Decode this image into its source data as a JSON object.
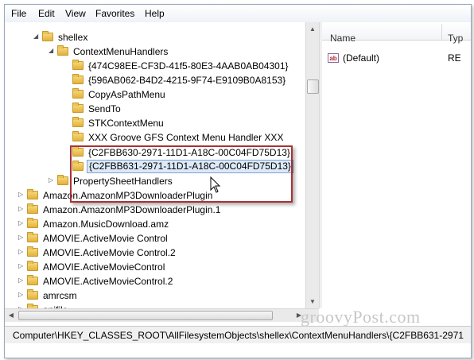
{
  "menu": {
    "items": [
      "File",
      "Edit",
      "View",
      "Favorites",
      "Help"
    ]
  },
  "tree": {
    "rows": [
      {
        "label": "shellex",
        "expander": "◢"
      },
      {
        "label": "ContextMenuHandlers",
        "expander": "◢"
      },
      {
        "label": "{474C98EE-CF3D-41f5-80E3-4AAB0AB04301}",
        "expander": ""
      },
      {
        "label": "{596AB062-B4D2-4215-9F74-E9109B0A8153}",
        "expander": ""
      },
      {
        "label": "CopyAsPathMenu",
        "expander": ""
      },
      {
        "label": "SendTo",
        "expander": ""
      },
      {
        "label": "STKContextMenu",
        "expander": ""
      },
      {
        "label": "XXX Groove GFS Context Menu Handler XXX",
        "expander": ""
      },
      {
        "label": "{C2FBB630-2971-11D1-A18C-00C04FD75D13}",
        "expander": ""
      },
      {
        "label": "{C2FBB631-2971-11D1-A18C-00C04FD75D13}",
        "expander": "",
        "selected": true
      },
      {
        "label": "PropertySheetHandlers",
        "expander": "▷"
      },
      {
        "label": "Amazon.AmazonMP3DownloaderPlugin",
        "expander": "▷"
      },
      {
        "label": "Amazon.AmazonMP3DownloaderPlugin.1",
        "expander": "▷"
      },
      {
        "label": "Amazon.MusicDownload.amz",
        "expander": "▷"
      },
      {
        "label": "AMOVIE.ActiveMovie Control",
        "expander": "▷"
      },
      {
        "label": "AMOVIE.ActiveMovie Control.2",
        "expander": "▷"
      },
      {
        "label": "AMOVIE.ActiveMovieControl",
        "expander": "▷"
      },
      {
        "label": "AMOVIE.ActiveMovieControl.2",
        "expander": "▷"
      },
      {
        "label": "amrcsm",
        "expander": "▷"
      },
      {
        "label": "anifile",
        "expander": "▷"
      }
    ]
  },
  "values": {
    "col_name": "Name",
    "col_type": "Typ",
    "rows": [
      {
        "name": "(Default)",
        "type": "RE",
        "icon": "ab"
      }
    ]
  },
  "status": {
    "path": "Computer\\HKEY_CLASSES_ROOT\\AllFilesystemObjects\\shellex\\ContextMenuHandlers\\{C2FBB631-2971"
  },
  "watermark": "groovyPost.com",
  "colors": {
    "highlight_border": "#a83232",
    "selection_bg": "#dde9f8",
    "folder": "#e3b23c"
  }
}
